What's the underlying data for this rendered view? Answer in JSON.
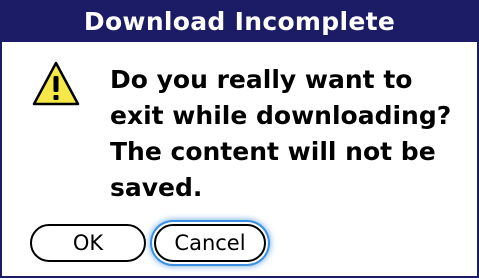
{
  "dialog": {
    "title": "Download Incomplete",
    "icon": "warning-icon",
    "message": "Do you really want to\nexit while downloading?\nThe content will not be\nsaved.",
    "buttons": {
      "ok_label": "OK",
      "cancel_label": "Cancel"
    }
  },
  "colors": {
    "titlebar": "#1c1c66",
    "focus_ring": "#3a8fe0",
    "warning_fill": "#f7e84a"
  }
}
